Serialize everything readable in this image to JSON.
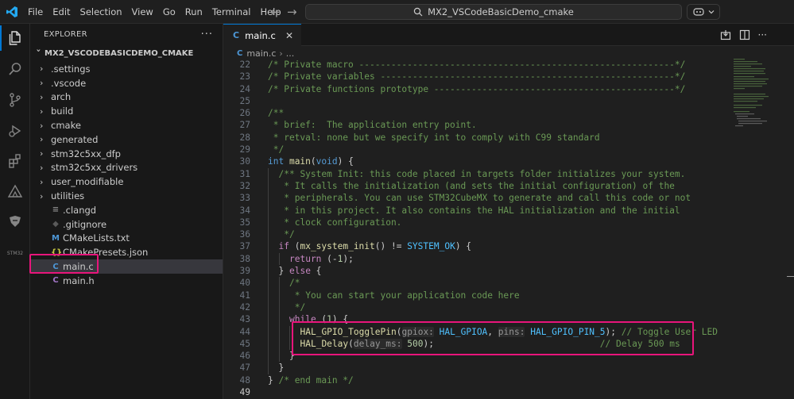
{
  "menu": [
    "File",
    "Edit",
    "Selection",
    "View",
    "Go",
    "Run",
    "Terminal",
    "Help"
  ],
  "command_center": {
    "text": "MX2_VSCodeBasicDemo_cmake"
  },
  "activity_bar": {
    "stm_label": "STM32"
  },
  "explorer": {
    "title": "EXPLORER",
    "more": "···",
    "root": "MX2_VSCODEBASICDEMO_CMAKE",
    "items": [
      {
        "label": ".settings",
        "type": "folder"
      },
      {
        "label": ".vscode",
        "type": "folder"
      },
      {
        "label": "arch",
        "type": "folder"
      },
      {
        "label": "build",
        "type": "folder"
      },
      {
        "label": "cmake",
        "type": "folder"
      },
      {
        "label": "generated",
        "type": "folder"
      },
      {
        "label": "stm32c5xx_dfp",
        "type": "folder"
      },
      {
        "label": "stm32c5xx_drivers",
        "type": "folder"
      },
      {
        "label": "user_modifiable",
        "type": "folder"
      },
      {
        "label": "utilities",
        "type": "folder"
      },
      {
        "label": ".clangd",
        "type": "file",
        "icon": "≡",
        "icon_color": "#8a8a8a"
      },
      {
        "label": ".gitignore",
        "type": "file",
        "icon": "◆",
        "icon_color": "#5a5a5a"
      },
      {
        "label": "CMakeLists.txt",
        "type": "file",
        "icon": "M",
        "icon_color": "#4d97d6"
      },
      {
        "label": "CMakePresets.json",
        "type": "file",
        "icon": "{}",
        "icon_color": "#cbcb41"
      },
      {
        "label": "main.c",
        "type": "file",
        "icon": "C",
        "icon_color": "#4d97d6",
        "selected": true
      },
      {
        "label": "main.h",
        "type": "file",
        "icon": "C",
        "icon_color": "#a074c4"
      }
    ]
  },
  "tab": {
    "label": "main.c",
    "icon": "C",
    "close": "✕"
  },
  "breadcrumb": {
    "file": "main.c",
    "separator": "›",
    "rest": "..."
  },
  "code_lines": [
    {
      "n": "22",
      "indent": 0,
      "tokens": [
        [
          "cm",
          "/* Private macro -----------------------------------------------------------*/"
        ]
      ]
    },
    {
      "n": "23",
      "indent": 0,
      "tokens": [
        [
          "cm",
          "/* Private variables -------------------------------------------------------*/"
        ]
      ]
    },
    {
      "n": "24",
      "indent": 0,
      "tokens": [
        [
          "cm",
          "/* Private functions prototype ---------------------------------------------*/"
        ]
      ]
    },
    {
      "n": "25",
      "indent": 0,
      "tokens": []
    },
    {
      "n": "26",
      "indent": 0,
      "tokens": [
        [
          "cm",
          "/**"
        ]
      ]
    },
    {
      "n": "27",
      "indent": 0,
      "tokens": [
        [
          "cm",
          " * brief:  The application entry point."
        ]
      ]
    },
    {
      "n": "28",
      "indent": 0,
      "tokens": [
        [
          "cm",
          " * retval: none but we specify int to comply with C99 standard"
        ]
      ]
    },
    {
      "n": "29",
      "indent": 0,
      "tokens": [
        [
          "cm",
          " */"
        ]
      ]
    },
    {
      "n": "30",
      "indent": 0,
      "tokens": [
        [
          "kw",
          "int "
        ],
        [
          "fn",
          "main"
        ],
        [
          "txt",
          "("
        ],
        [
          "kw",
          "void"
        ],
        [
          "txt",
          ") {"
        ]
      ]
    },
    {
      "n": "31",
      "indent": 1,
      "tokens": [
        [
          "cm",
          "/** System Init: this code placed in targets folder initializes your system."
        ]
      ]
    },
    {
      "n": "32",
      "indent": 1,
      "tokens": [
        [
          "cm",
          " * It calls the initialization (and sets the initial configuration) of the"
        ]
      ]
    },
    {
      "n": "33",
      "indent": 1,
      "tokens": [
        [
          "cm",
          " * peripherals. You can use STM32CubeMX to generate and call this code or not"
        ]
      ]
    },
    {
      "n": "34",
      "indent": 1,
      "tokens": [
        [
          "cm",
          " * in this project. It also contains the HAL initialization and the initial"
        ]
      ]
    },
    {
      "n": "35",
      "indent": 1,
      "tokens": [
        [
          "cm",
          " * clock configuration."
        ]
      ]
    },
    {
      "n": "36",
      "indent": 1,
      "tokens": [
        [
          "cm",
          " */"
        ]
      ]
    },
    {
      "n": "37",
      "indent": 1,
      "tokens": [
        [
          "ctl",
          "if "
        ],
        [
          "txt",
          "("
        ],
        [
          "fn",
          "mx_system_init"
        ],
        [
          "txt",
          "() != "
        ],
        [
          "mac",
          "SYSTEM_OK"
        ],
        [
          "txt",
          ") {"
        ]
      ]
    },
    {
      "n": "38",
      "indent": 2,
      "tokens": [
        [
          "ctl",
          "return "
        ],
        [
          "txt",
          "(-"
        ],
        [
          "num",
          "1"
        ],
        [
          "txt",
          ");"
        ]
      ]
    },
    {
      "n": "39",
      "indent": 1,
      "tokens": [
        [
          "txt",
          "} "
        ],
        [
          "ctl",
          "else "
        ],
        [
          "txt",
          "{"
        ]
      ]
    },
    {
      "n": "40",
      "indent": 2,
      "tokens": [
        [
          "cm",
          "/*"
        ]
      ]
    },
    {
      "n": "41",
      "indent": 2,
      "tokens": [
        [
          "cm",
          " * You can start your application code here"
        ]
      ]
    },
    {
      "n": "42",
      "indent": 2,
      "tokens": [
        [
          "cm",
          " */"
        ]
      ]
    },
    {
      "n": "43",
      "indent": 2,
      "tokens": [
        [
          "ctl",
          "while "
        ],
        [
          "txt",
          "("
        ],
        [
          "num",
          "1"
        ],
        [
          "txt",
          ") {"
        ]
      ]
    },
    {
      "n": "44",
      "indent": 3,
      "tokens": [
        [
          "fn",
          "HAL_GPIO_TogglePin"
        ],
        [
          "txt",
          "("
        ],
        [
          "hint",
          "gpiox:"
        ],
        [
          "txt",
          " "
        ],
        [
          "mac",
          "HAL_GPIOA"
        ],
        [
          "txt",
          ", "
        ],
        [
          "hint",
          "pins:"
        ],
        [
          "txt",
          " "
        ],
        [
          "mac",
          "HAL_GPIO_PIN_5"
        ],
        [
          "txt",
          "); "
        ],
        [
          "cm",
          "// Toggle User LED"
        ]
      ]
    },
    {
      "n": "45",
      "indent": 3,
      "tokens": [
        [
          "fn",
          "HAL_Delay"
        ],
        [
          "txt",
          "("
        ],
        [
          "hint",
          "delay_ms:"
        ],
        [
          "txt",
          " "
        ],
        [
          "num",
          "500"
        ],
        [
          "txt",
          ");                               "
        ],
        [
          "cm",
          "// Delay 500 ms"
        ]
      ]
    },
    {
      "n": "46",
      "indent": 2,
      "tokens": [
        [
          "txt",
          "}"
        ]
      ]
    },
    {
      "n": "47",
      "indent": 1,
      "tokens": [
        [
          "txt",
          "}"
        ]
      ]
    },
    {
      "n": "48",
      "indent": 0,
      "tokens": [
        [
          "txt",
          "} "
        ],
        [
          "cm",
          "/* end main */"
        ]
      ]
    },
    {
      "n": "49",
      "indent": 0,
      "tokens": [],
      "active": true
    }
  ],
  "colors": {
    "accent": "#0078d4",
    "highlight_box": "#e8157b"
  }
}
